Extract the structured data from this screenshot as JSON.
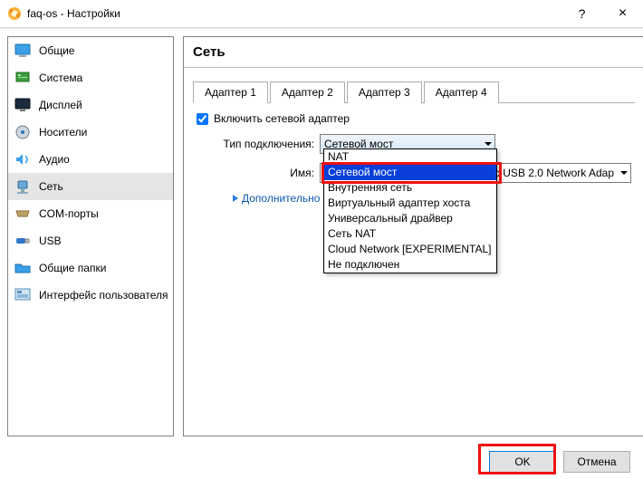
{
  "window": {
    "title": "faq-os - Настройки",
    "help_tooltip": "?",
    "close_tooltip": "×"
  },
  "sidebar": {
    "items": [
      {
        "label": "Общие"
      },
      {
        "label": "Система"
      },
      {
        "label": "Дисплей"
      },
      {
        "label": "Носители"
      },
      {
        "label": "Аудио"
      },
      {
        "label": "Сеть"
      },
      {
        "label": "COM-порты"
      },
      {
        "label": "USB"
      },
      {
        "label": "Общие папки"
      },
      {
        "label": "Интерфейс пользователя"
      }
    ],
    "selected_index": 5
  },
  "page": {
    "title": "Сеть",
    "tabs": [
      "Адаптер 1",
      "Адаптер 2",
      "Адаптер 3",
      "Адаптер 4"
    ],
    "active_tab": 0,
    "enable_adapter_label": "Включить сетевой адаптер",
    "enable_adapter_checked": true,
    "attachment_label": "Тип подключения:",
    "attachment_value": "Сетевой мост",
    "attachment_options": [
      "NAT",
      "Сетевой мост",
      "Внутренняя сеть",
      "Виртуальный адаптер хоста",
      "Универсальный драйвер",
      "Сеть NAT",
      "Cloud Network [EXPERIMENTAL]",
      "Не подключен"
    ],
    "attachment_selected_index": 1,
    "name_label": "Имя:",
    "name_value": "2.11ac USB 2.0 Network Adap",
    "advanced_label": "Дополнительно"
  },
  "footer": {
    "ok": "OK",
    "cancel": "Отмена"
  }
}
